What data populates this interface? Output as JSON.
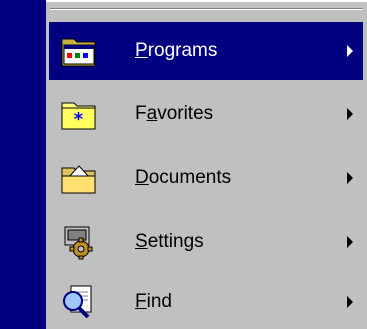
{
  "menu": {
    "items": [
      {
        "label": "Programs",
        "accel": "P",
        "rest": "rograms",
        "icon": "programs-folder-icon",
        "has_submenu": true,
        "selected": true
      },
      {
        "label": "Favorites",
        "pre": "F",
        "accel": "a",
        "rest": "vorites",
        "icon": "favorites-folder-icon",
        "has_submenu": true,
        "selected": false
      },
      {
        "label": "Documents",
        "accel": "D",
        "rest": "ocuments",
        "icon": "documents-folder-icon",
        "has_submenu": true,
        "selected": false
      },
      {
        "label": "Settings",
        "accel": "S",
        "rest": "ettings",
        "icon": "settings-gear-icon",
        "has_submenu": true,
        "selected": false
      },
      {
        "label": "Find",
        "accel": "F",
        "rest": "ind",
        "icon": "find-magnifier-icon",
        "has_submenu": true,
        "selected": false
      }
    ]
  },
  "colors": {
    "banner": "#000080",
    "menu_background": "#c0c0c0",
    "selection": "#000080"
  }
}
